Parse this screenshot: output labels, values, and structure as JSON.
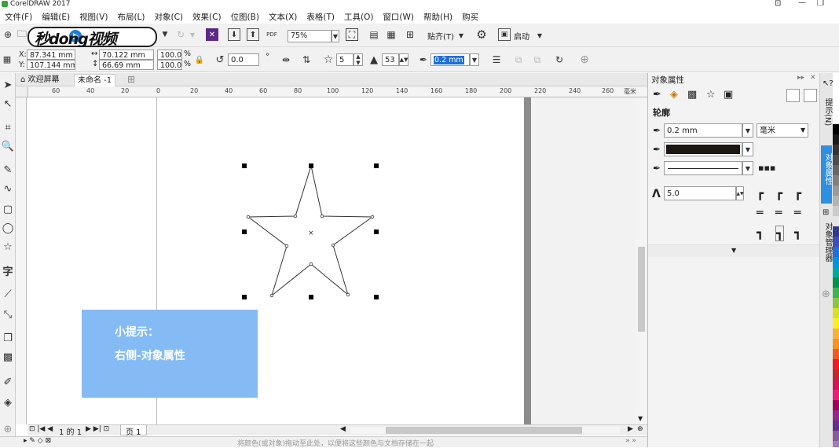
{
  "app": {
    "title": "CorelDRAW 2017"
  },
  "menu": [
    "文件(F)",
    "编辑(E)",
    "视图(V)",
    "布局(L)",
    "对象(C)",
    "效果(C)",
    "位图(B)",
    "文本(X)",
    "表格(T)",
    "工具(O)",
    "窗口(W)",
    "帮助(H)",
    "购买"
  ],
  "toolbar": {
    "zoom": "75%",
    "snap_label": "贴齐(T)",
    "launch_label": "启动"
  },
  "property_bar": {
    "x_label": "X:",
    "x_value": "87.341 mm",
    "y_label": "Y:",
    "y_value": "107.144 mm",
    "w_value": "70.122 mm",
    "h_value": "66.69 mm",
    "scale_x": "100.0",
    "scale_y": "100.0",
    "percent": "%",
    "rotation": "0.0",
    "degree": "°",
    "points": "5",
    "sharpness": "53",
    "outline_width": "0.2 mm"
  },
  "tabs": {
    "welcome": "欢迎屏幕",
    "doc": "未命名 -1"
  },
  "ruler_h_ticks": [
    "60",
    "40",
    "20",
    "0",
    "20",
    "40",
    "60",
    "80",
    "100",
    "120",
    "140",
    "160",
    "180",
    "200",
    "220",
    "240",
    "260"
  ],
  "ruler_units": "毫米",
  "watermark": {
    "text": "秒dong视频"
  },
  "tip": {
    "title": "小提示：",
    "body": "右侧-对象属性"
  },
  "page_nav": {
    "position": "1 的 1",
    "page_tab": "页 1"
  },
  "status": {
    "hint": "将颜色(或对象)拖动至此处，以便将这些颜色与文档存储在一起"
  },
  "panel": {
    "title": "对象属性",
    "section": "轮廓",
    "width_value": "0.2 mm",
    "unit": "毫米",
    "miter": "5.0"
  },
  "dock_tabs": [
    "提示(N)",
    "对象属性",
    "对象管理器"
  ],
  "palette_colors": [
    "#ffffff",
    "#000000",
    "#1a1a1a",
    "#333333",
    "#4d4d4d",
    "#666666",
    "#808080",
    "#999999",
    "#b3b3b3",
    "#cccccc",
    "#e6e6e6",
    "#2e3a8c",
    "#3b4fb5",
    "#1e6fd9",
    "#0094d9",
    "#00a99d",
    "#009245",
    "#39b54a",
    "#8cc63f",
    "#d9e021",
    "#fcee21",
    "#fbb03b",
    "#f7931e",
    "#f15a24",
    "#ed1c24",
    "#c1272d",
    "#d4145a",
    "#ed1e79",
    "#9e005d",
    "#93278f",
    "#662d91",
    "#8b5a9f",
    "#a07fb8",
    "#b3a0cc"
  ]
}
